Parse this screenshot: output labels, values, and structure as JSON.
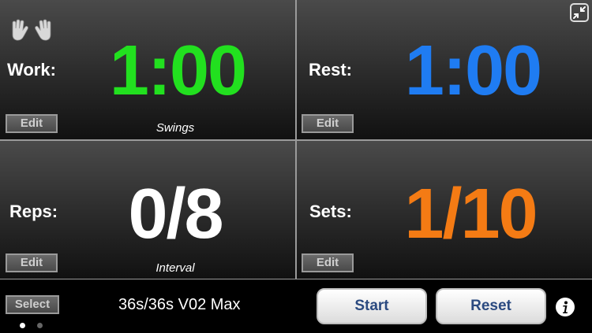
{
  "work": {
    "label": "Work:",
    "time": "1:00",
    "edit": "Edit",
    "caption": "Swings",
    "color": "#22e01f"
  },
  "rest": {
    "label": "Rest:",
    "time": "1:00",
    "edit": "Edit",
    "color": "#1f7cf2"
  },
  "reps": {
    "label": "Reps:",
    "value": "0/8",
    "edit": "Edit",
    "caption": "Interval",
    "color": "#ffffff"
  },
  "sets": {
    "label": "Sets:",
    "value": "1/10",
    "edit": "Edit",
    "color": "#f47b14"
  },
  "bottom": {
    "select_label": "Select",
    "program_name": "36s/36s V02 Max",
    "start_label": "Start",
    "reset_label": "Reset",
    "page_dots": {
      "total": 2,
      "active": 1
    }
  },
  "icons": {
    "hands": "raised-hands-icon",
    "collapse": "collapse-icon",
    "info": "info-icon"
  }
}
